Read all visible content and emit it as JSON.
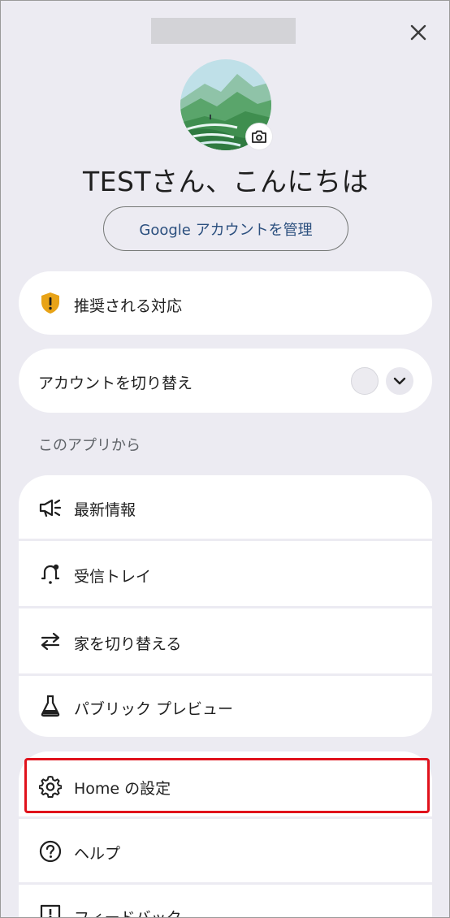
{
  "header": {
    "close_icon": "close-icon"
  },
  "profile": {
    "greeting": "TESTさん、こんにちは",
    "manage_account_label": "Google アカウントを管理",
    "camera_icon": "camera-icon"
  },
  "recommended": {
    "label": "推奨される対応",
    "icon": "shield-alert-icon",
    "icon_color": "#e8a317"
  },
  "switch_account": {
    "label": "アカウントを切り替え",
    "chevron_icon": "chevron-down-icon"
  },
  "app_section": {
    "heading": "このアプリから",
    "items": [
      {
        "label": "最新情報",
        "icon": "megaphone-icon"
      },
      {
        "label": "受信トレイ",
        "icon": "bell-icon"
      },
      {
        "label": "家を切り替える",
        "icon": "swap-arrows-icon"
      },
      {
        "label": "パブリック プレビュー",
        "icon": "flask-icon"
      }
    ]
  },
  "settings_section": {
    "items": [
      {
        "label": "Home の設定",
        "icon": "gear-icon"
      },
      {
        "label": "ヘルプ",
        "icon": "help-circle-icon"
      },
      {
        "label": "フィードバック",
        "icon": "feedback-icon"
      }
    ]
  },
  "colors": {
    "background": "#ecebf2",
    "highlight": "#e0121c",
    "manage_text": "#2b4f7e"
  }
}
